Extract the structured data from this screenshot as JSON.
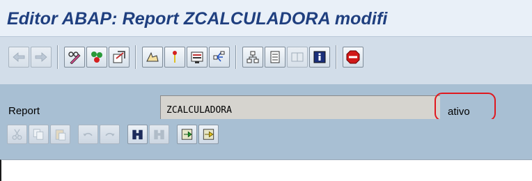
{
  "window": {
    "title": "Editor ABAP: Report ZCALCULADORA modifi"
  },
  "toolbar": {
    "buttons": [
      {
        "name": "back-button",
        "icon": "arrow-left-icon",
        "enabled": false
      },
      {
        "name": "forward-button",
        "icon": "arrow-right-icon",
        "enabled": false
      },
      {
        "name": "display-change-button",
        "icon": "pencil-glasses-icon",
        "enabled": true
      },
      {
        "name": "check-button",
        "icon": "check-syntax-icon",
        "enabled": true
      },
      {
        "name": "activate-button",
        "icon": "activate-icon",
        "enabled": true
      },
      {
        "name": "test-button",
        "icon": "test-run-icon",
        "enabled": true
      },
      {
        "name": "where-used-button",
        "icon": "where-used-icon",
        "enabled": true
      },
      {
        "name": "display-object-list-button",
        "icon": "object-list-icon",
        "enabled": true
      },
      {
        "name": "navigation-button",
        "icon": "navigation-icon",
        "enabled": true
      },
      {
        "name": "hierarchy-button",
        "icon": "hierarchy-icon",
        "enabled": true
      },
      {
        "name": "pattern-button",
        "icon": "pattern-icon",
        "enabled": true
      },
      {
        "name": "split-screen-button",
        "icon": "split-screen-icon",
        "enabled": false
      },
      {
        "name": "info-button",
        "icon": "info-icon",
        "enabled": true
      },
      {
        "name": "stop-button",
        "icon": "stop-icon",
        "enabled": true
      }
    ]
  },
  "report": {
    "label": "Report",
    "value": "ZCALCULADORA",
    "status": "ativo",
    "status_highlight_color": "#e0181e"
  },
  "editor_toolbar": {
    "buttons": [
      {
        "name": "cut-button",
        "icon": "scissors-icon",
        "enabled": false
      },
      {
        "name": "copy-button",
        "icon": "copy-icon",
        "enabled": false
      },
      {
        "name": "paste-button",
        "icon": "paste-icon",
        "enabled": false
      },
      {
        "name": "undo-button",
        "icon": "undo-icon",
        "enabled": false
      },
      {
        "name": "redo-button",
        "icon": "redo-icon",
        "enabled": false
      },
      {
        "name": "find-button",
        "icon": "binoculars-icon",
        "enabled": true
      },
      {
        "name": "find-next-button",
        "icon": "binoculars-plus-icon",
        "enabled": false
      },
      {
        "name": "insert-module-button",
        "icon": "insert-icon",
        "enabled": true
      },
      {
        "name": "export-button",
        "icon": "export-icon",
        "enabled": true
      }
    ]
  }
}
